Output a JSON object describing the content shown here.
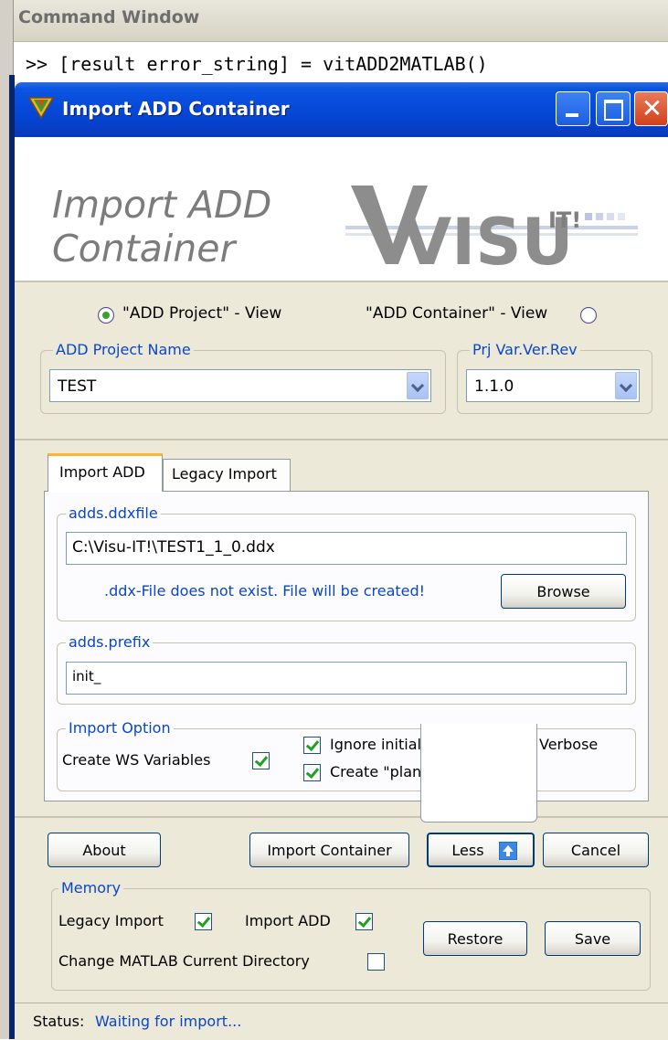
{
  "command_window": {
    "title": "Command Window",
    "command_line": ">> [result error_string] = vitADD2MATLAB()"
  },
  "dialog": {
    "title": "Import ADD Container",
    "header_title": "Import ADD Container",
    "logo_text": "VISU",
    "logo_suffix": "IT!"
  },
  "view": {
    "project_view_label": "\"ADD Project\" - View",
    "container_view_label": "\"ADD Container\" - View",
    "selected": "project"
  },
  "project": {
    "name_group": "ADD Project Name",
    "name_value": "TEST",
    "version_group": "Prj Var.Ver.Rev",
    "version_value": "1.1.0"
  },
  "tabs": [
    {
      "label": "Import ADD",
      "active": true
    },
    {
      "label": "Legacy Import",
      "active": false
    }
  ],
  "import_add": {
    "ddxfile_group": "adds.ddxfile",
    "ddxfile_value": "C:\\Visu-IT!\\TEST1_1_0.ddx",
    "ddx_message": ".ddx-File does not exist. File will be created!",
    "browse_label": "Browse",
    "prefix_group": "adds.prefix",
    "prefix_value": "init_",
    "option_group": "Import Option",
    "create_ws_label": "Create WS Variables",
    "create_ws_checked": true,
    "ignore_initial_label": "Ignore initial Values",
    "ignore_initial_checked": true,
    "verbose_label": "Verbose",
    "verbose_checked": true,
    "create_plane_label": "Create \"plane\" WS Variables",
    "create_plane_checked": true
  },
  "buttons": {
    "about": "About",
    "import_container": "Import Container",
    "less": "Less",
    "cancel": "Cancel",
    "restore": "Restore",
    "save": "Save"
  },
  "memory": {
    "group": "Memory",
    "legacy_import_label": "Legacy Import",
    "legacy_import_checked": true,
    "import_add_label": "Import ADD",
    "import_add_checked": true,
    "change_dir_label": "Change MATLAB Current Directory",
    "change_dir_checked": false
  },
  "status": {
    "label": "Status:",
    "value": "Waiting for import..."
  },
  "colors": {
    "titlebar": "#0648d8",
    "group_title": "#0a46c8",
    "check_mark": "#21a121",
    "dialog_bg": "#ece9d8"
  }
}
